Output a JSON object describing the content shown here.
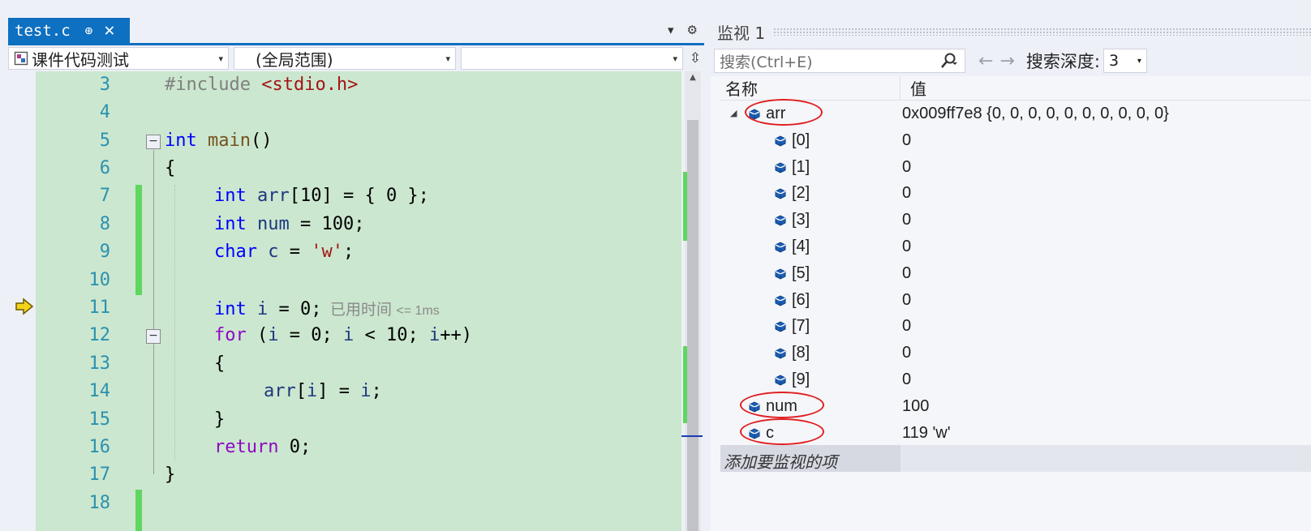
{
  "editor": {
    "tab": {
      "label": "test.c",
      "pin": "⊕",
      "close": "✕"
    },
    "tab_tools": {
      "dropdown": "▾",
      "gear": "⚙"
    },
    "nav": {
      "project": "课件代码测试",
      "scope": "(全局范围)",
      "member": "",
      "split": "⇳"
    },
    "lines": [
      {
        "n": "3"
      },
      {
        "n": "4"
      },
      {
        "n": "5"
      },
      {
        "n": "6"
      },
      {
        "n": "7"
      },
      {
        "n": "8"
      },
      {
        "n": "9"
      },
      {
        "n": "10"
      },
      {
        "n": "11"
      },
      {
        "n": "12"
      },
      {
        "n": "13"
      },
      {
        "n": "14"
      },
      {
        "n": "15"
      },
      {
        "n": "16"
      },
      {
        "n": "17"
      },
      {
        "n": "18"
      }
    ],
    "code": {
      "l3_pre": "#include ",
      "l3_hdr": "<stdio.h>",
      "l5_kw": "int",
      "l5_fn": " main",
      "l5_rest": "()",
      "l6": "{",
      "l7_kw": "int",
      "l7_var": " arr",
      "l7_rest": "[10] = { 0 };",
      "l8_kw": "int",
      "l8_var": " num",
      "l8_rest": " = 100;",
      "l9_kw": "char",
      "l9_var": " c",
      "l9_eq": " = ",
      "l9_str": "'w'",
      "l9_end": ";",
      "l11_kw": "int",
      "l11_var": " i",
      "l11_rest": " = 0;",
      "l11_elapsed": "已用时间",
      "l11_elapsed_val": "<= 1ms",
      "l12_kw": "for",
      "l12_rest1": " (",
      "l12_v1": "i",
      "l12_rest2": " = 0; ",
      "l12_v2": "i",
      "l12_rest3": " < 10; ",
      "l12_v3": "i",
      "l12_rest4": "++)",
      "l13": "{",
      "l14_var": "arr",
      "l14_mid": "[",
      "l14_v": "i",
      "l14_rest": "] = ",
      "l14_v2": "i",
      "l14_end": ";",
      "l15": "}",
      "l16_kw": "return",
      "l16_rest": " 0;",
      "l17": "}"
    },
    "fold_minus": "−"
  },
  "watch": {
    "title": "监视 1",
    "search_placeholder": "搜索(Ctrl+E)",
    "search_icon": "⚲",
    "nav_arrows": "←→",
    "depth_label": "搜索深度:",
    "depth_value": "3",
    "col_name": "名称",
    "col_value": "值",
    "rows": [
      {
        "name": "arr",
        "value": "0x009ff7e8 {0, 0, 0, 0, 0, 0, 0, 0, 0, 0}"
      },
      {
        "name": "[0]",
        "value": "0"
      },
      {
        "name": "[1]",
        "value": "0"
      },
      {
        "name": "[2]",
        "value": "0"
      },
      {
        "name": "[3]",
        "value": "0"
      },
      {
        "name": "[4]",
        "value": "0"
      },
      {
        "name": "[5]",
        "value": "0"
      },
      {
        "name": "[6]",
        "value": "0"
      },
      {
        "name": "[7]",
        "value": "0"
      },
      {
        "name": "[8]",
        "value": "0"
      },
      {
        "name": "[9]",
        "value": "0"
      },
      {
        "name": "num",
        "value": "100"
      },
      {
        "name": "c",
        "value": "119 'w'"
      }
    ],
    "add_item": "添加要监视的项"
  },
  "colors": {
    "tab_blue": "#0e70c0",
    "code_bg": "#cbe7cf",
    "keyword": "#0000ff",
    "control_keyword": "#8f08c4",
    "string": "#a31515",
    "line_number": "#2b91af",
    "highlight_ring": "#e02020",
    "change_bar": "#5fd65f"
  }
}
